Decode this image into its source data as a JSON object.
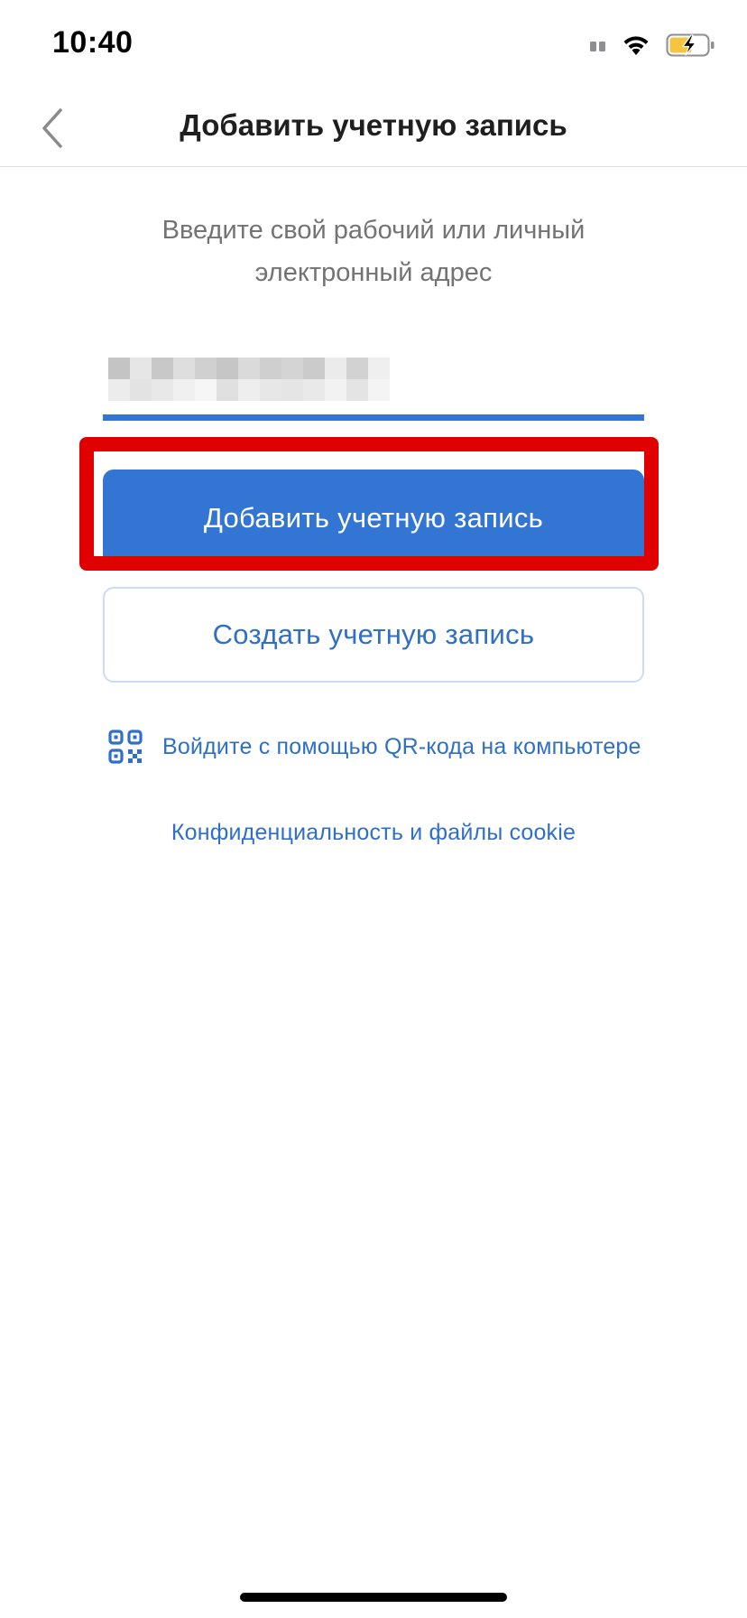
{
  "status_bar": {
    "time": "10:40",
    "icons": [
      "signal-icon",
      "wifi-icon",
      "battery-charging-icon"
    ],
    "battery_color": "#f5c542"
  },
  "nav": {
    "back_icon": "chevron-left-icon",
    "title": "Добавить учетную запись"
  },
  "instruction": "Введите свой рабочий или личный электронный адрес",
  "email_field": {
    "value_state": "obscured"
  },
  "buttons": {
    "add_account": "Добавить учетную запись",
    "create_account": "Создать учетную запись"
  },
  "annotation": {
    "highlight_target": "add-account-button",
    "color": "#e00000"
  },
  "links": {
    "qr_icon": "qr-code-icon",
    "qr_login": "Войдите с помощью QR-кода на компьютере",
    "privacy": "Конфиденциальность и файлы cookie"
  },
  "colors": {
    "accent": "#3375d3",
    "link": "#2f6fc7",
    "muted_text": "#737373"
  }
}
